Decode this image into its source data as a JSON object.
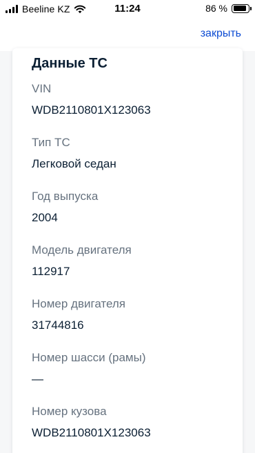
{
  "status_bar": {
    "carrier": "Beeline KZ",
    "time": "11:24",
    "battery_text": "86 %",
    "battery_level": 0.86
  },
  "header": {
    "close_label": "закрыть",
    "accent_color": "#0d4cd3"
  },
  "vehicle": {
    "title": "Данные ТС",
    "fields": [
      {
        "label": "VIN",
        "value": "WDB2110801X123063"
      },
      {
        "label": "Тип ТС",
        "value": "Легковой седан"
      },
      {
        "label": "Год выпуска",
        "value": "2004"
      },
      {
        "label": "Модель двигателя",
        "value": "112917"
      },
      {
        "label": "Номер двигателя",
        "value": "31744816"
      },
      {
        "label": "Номер шасси (рамы)",
        "value": "—"
      },
      {
        "label": "Номер кузова",
        "value": "WDB2110801X123063"
      }
    ]
  },
  "icons": {
    "signal": "cellular-signal-icon",
    "wifi": "wifi-icon",
    "battery": "battery-icon"
  }
}
